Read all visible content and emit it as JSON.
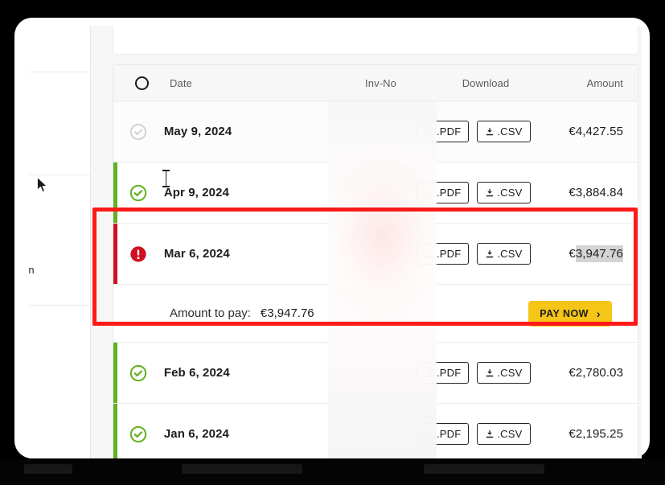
{
  "sidebar": {
    "partial_label": "on"
  },
  "table": {
    "headers": {
      "status": "status-circle",
      "date": "Date",
      "invoice_no": "Inv-No",
      "download": "Download",
      "amount": "Amount"
    },
    "rows": [
      {
        "status": "pending",
        "status_icon": "check-circle-gray-icon",
        "accent": "none",
        "date": "May 9, 2024",
        "invoice_no": "",
        "pdf_label": ".PDF",
        "csv_label": ".CSV",
        "amount": "€4,427.55",
        "amount_selected": false
      },
      {
        "status": "paid",
        "status_icon": "check-circle-green-icon",
        "accent": "green",
        "date": "Apr 9, 2024",
        "invoice_no": "",
        "pdf_label": ".PDF",
        "csv_label": ".CSV",
        "amount": "€3,884.84",
        "amount_selected": false
      },
      {
        "status": "overdue",
        "status_icon": "exclamation-circle-red-icon",
        "accent": "red",
        "date": "Mar 6, 2024",
        "invoice_no": "",
        "pdf_label": ".PDF",
        "csv_label": ".CSV",
        "amount_prefix": "€",
        "amount_selected_text": "3,947.76",
        "amount": "€3,947.76",
        "amount_selected": true
      },
      {
        "status": "paid",
        "status_icon": "check-circle-green-icon",
        "accent": "green",
        "date": "Feb 6, 2024",
        "invoice_no": "",
        "pdf_label": ".PDF",
        "csv_label": ".CSV",
        "amount": "€2,780.03",
        "amount_selected": false
      },
      {
        "status": "paid",
        "status_icon": "check-circle-green-icon",
        "accent": "green",
        "date": "Jan 6, 2024",
        "invoice_no": "",
        "pdf_label": ".PDF",
        "csv_label": ".CSV",
        "amount": "€2,195.25",
        "amount_selected": false
      }
    ]
  },
  "pay_panel": {
    "label": "Amount to pay:",
    "amount": "€3,947.76",
    "button_label": "PAY NOW",
    "button_chevron": "›"
  },
  "colors": {
    "accent_green": "#63b023",
    "accent_red": "#cf1020",
    "pay_button": "#f5c518",
    "annotation_red": "#ff1a1a",
    "selection_gray": "#d4d4d4"
  },
  "annotation": {
    "shape": "rectangle-highlight",
    "target": "overdue-invoice-and-pay-row"
  },
  "cursor": {
    "type": "arrow-pointer"
  }
}
